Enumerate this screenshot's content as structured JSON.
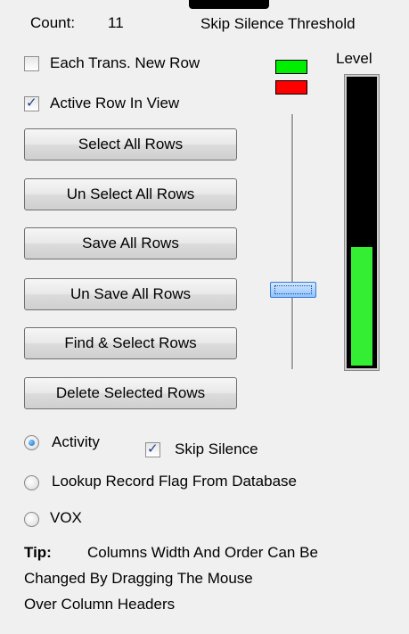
{
  "count": {
    "label": "Count:",
    "value": "11"
  },
  "threshold": {
    "label": "Skip Silence Threshold"
  },
  "level": {
    "label": "Level",
    "fraction": 0.41
  },
  "slider": {
    "fraction": 0.3
  },
  "checkboxes": {
    "each_trans": {
      "label": "Each Trans. New Row",
      "checked": false
    },
    "active_row": {
      "label": "Active Row In View",
      "checked": true
    },
    "skip_silence": {
      "label": "Skip Silence",
      "checked": true
    }
  },
  "buttons": {
    "select_all": "Select All Rows",
    "unselect_all": "Un Select All Rows",
    "save_all": "Save All Rows",
    "unsave_all": "Un Save All Rows",
    "find_select": "Find & Select Rows",
    "delete_selected": "Delete Selected Rows"
  },
  "radios": {
    "activity": {
      "label": "Activity",
      "selected": true
    },
    "lookup": {
      "label": "Lookup Record Flag From Database",
      "selected": false
    },
    "vox": {
      "label": "VOX",
      "selected": false
    }
  },
  "tip": {
    "label": "Tip:",
    "line1": "Columns Width And Order Can Be",
    "line2": "Changed By Dragging The Mouse",
    "line3": "Over Column Headers"
  },
  "indicator_colors": {
    "green": "#00ee00",
    "red": "#ff0000",
    "meter": "#33ee33"
  }
}
